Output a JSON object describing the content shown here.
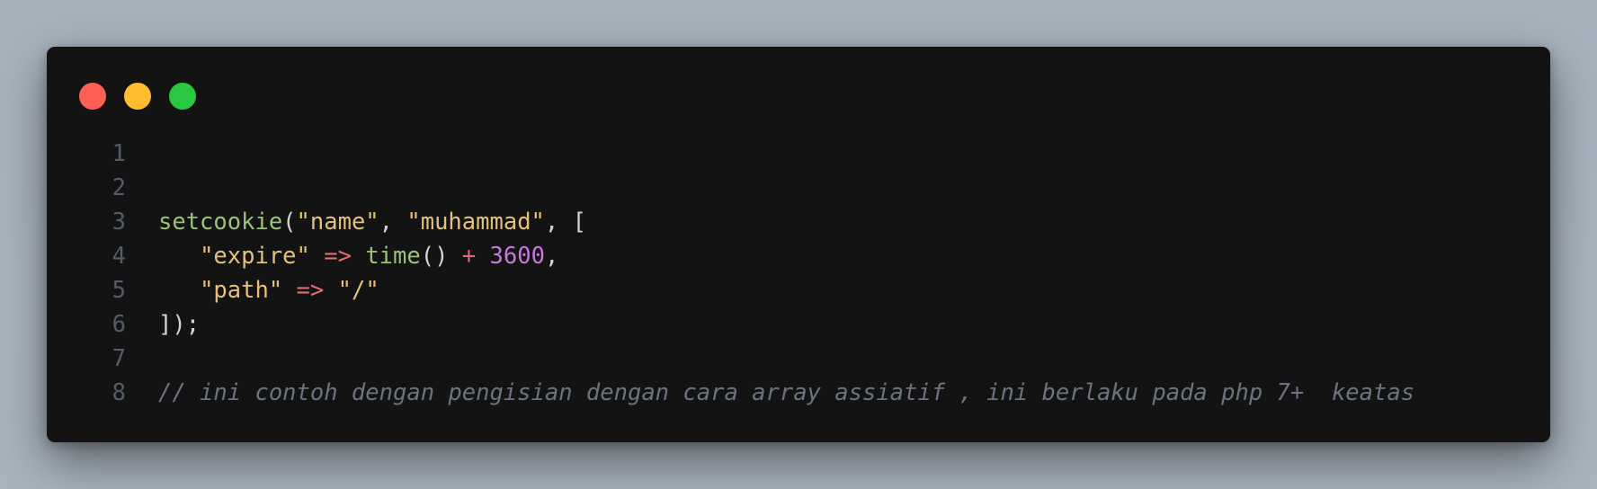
{
  "window": {
    "controls": {
      "close_color": "#ff5f57",
      "minimize_color": "#febc2e",
      "maximize_color": "#28c840"
    }
  },
  "code": {
    "line_numbers": [
      "1",
      "2",
      "3",
      "4",
      "5",
      "6",
      "7",
      "8"
    ],
    "line3": {
      "fn": "setcookie",
      "open": "(",
      "arg1": "\"name\"",
      "sep1": ", ",
      "arg2": "\"muhammad\"",
      "sep2": ", ["
    },
    "line4": {
      "indent": "   ",
      "key": "\"expire\"",
      "arrow": " => ",
      "fn": "time",
      "call": "()",
      "plus": " + ",
      "num": "3600",
      "comma": ","
    },
    "line5": {
      "indent": "   ",
      "key": "\"path\"",
      "arrow": " => ",
      "val": "\"/\""
    },
    "line6": {
      "close": "]);"
    },
    "line8": {
      "comment": "// ini contoh dengan pengisian dengan cara array assiatif , ini berlaku pada php 7+  keatas"
    }
  }
}
